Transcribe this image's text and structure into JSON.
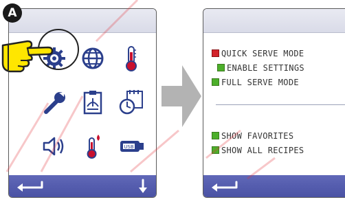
{
  "callout": {
    "label": "A"
  },
  "left_screen": {
    "icons": [
      "settings-gear-icon",
      "globe-icon",
      "thermometer-icon",
      "wrench-icon",
      "recipe-book-icon",
      "clock-calendar-icon",
      "speaker-icon",
      "thermometer-flame-icon",
      "usb-icon"
    ],
    "bottom_bar": {
      "back": "back-arrow-icon",
      "down": "down-arrow-icon"
    }
  },
  "right_screen": {
    "menu": [
      {
        "label": "QUICK SERVE MODE",
        "state": "red"
      },
      {
        "label": "ENABLE SETTINGS",
        "state": "green"
      },
      {
        "label": "FULL SERVE MODE",
        "state": "green"
      },
      {
        "label": "SHOW FAVORITES",
        "state": "green"
      },
      {
        "label": "SHOW ALL RECIPES",
        "state": "green"
      }
    ],
    "bottom_bar": {
      "back": "back-arrow-icon"
    }
  },
  "colors": {
    "topbar": "#dfe1ec",
    "bottombar": "#4f57a8",
    "check_red": "#d2232a",
    "check_green": "#4caf2a",
    "hand_fill": "#ffe600",
    "watermark": "#e4363c"
  }
}
